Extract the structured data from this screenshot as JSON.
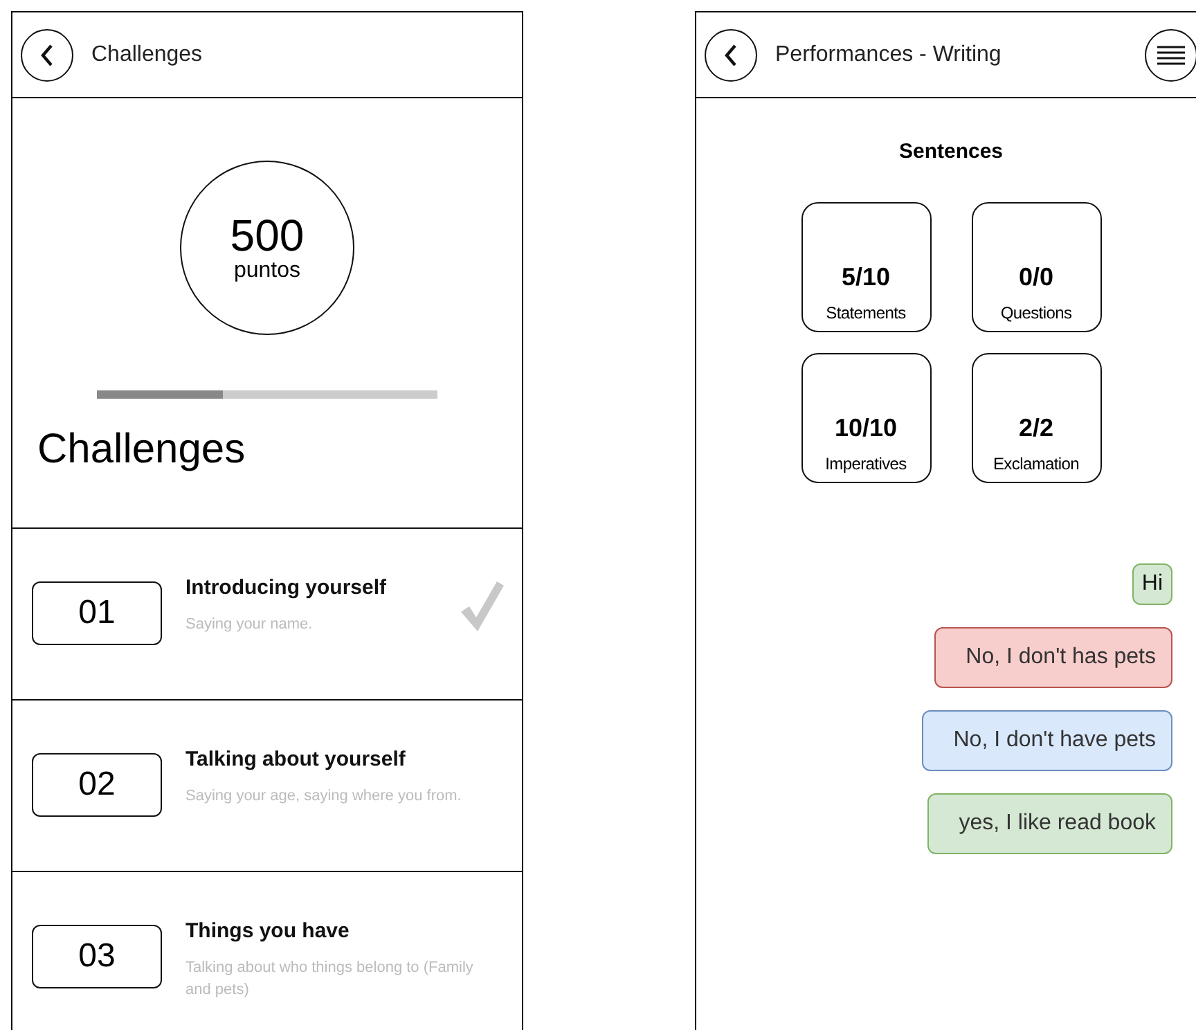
{
  "challenges_screen": {
    "title": "Challenges",
    "points": {
      "value": "500",
      "unit": "puntos"
    },
    "progress": {
      "level": 0.37
    },
    "heading": "Challenges",
    "challenges": [
      {
        "number": "01",
        "title": "Introducing yourself",
        "description": "Saying your name.",
        "completed": true
      },
      {
        "number": "02",
        "title": "Talking about yourself",
        "description": "Saying your age, saying where you from.",
        "completed": false
      },
      {
        "number": "03",
        "title": "Things you have",
        "description": "Talking about who things belong to (Family and pets)",
        "completed": false
      }
    ]
  },
  "performance_screen": {
    "title": "Performances - Writing",
    "section_title": "Sentences",
    "stats": [
      {
        "value": "5/10",
        "label": "Statements"
      },
      {
        "value": "0/0",
        "label": "Questions"
      },
      {
        "value": "10/10",
        "label": "Imperatives"
      },
      {
        "value": "2/2",
        "label": "Exclamation"
      }
    ],
    "messages": [
      {
        "text": "Hi",
        "color": "#d5e8d4"
      },
      {
        "text": "No, I don't has pets",
        "color": "#f8cecc"
      },
      {
        "text": "No, I don't have pets",
        "color": "#dae8fc"
      },
      {
        "text": "yes, I like read book",
        "color": "#d5e8d4"
      }
    ]
  }
}
